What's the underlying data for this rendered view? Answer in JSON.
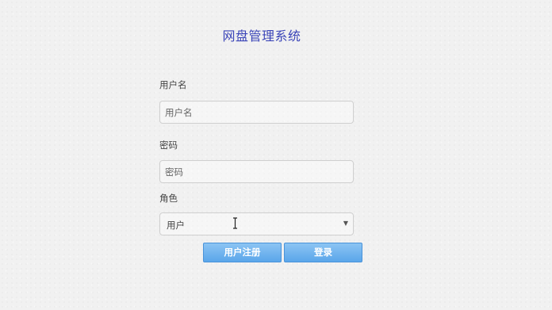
{
  "page": {
    "title": "网盘管理系统"
  },
  "form": {
    "username": {
      "label": "用户名",
      "placeholder": "用户名",
      "value": ""
    },
    "password": {
      "label": "密码",
      "placeholder": "密码",
      "value": ""
    },
    "role": {
      "label": "角色",
      "selected": "用户"
    }
  },
  "buttons": {
    "register_label": "用户注册",
    "login_label": "登录"
  },
  "colors": {
    "title": "#3b45b8",
    "button": "#5aa6ea",
    "background": "#f1f1f1"
  }
}
